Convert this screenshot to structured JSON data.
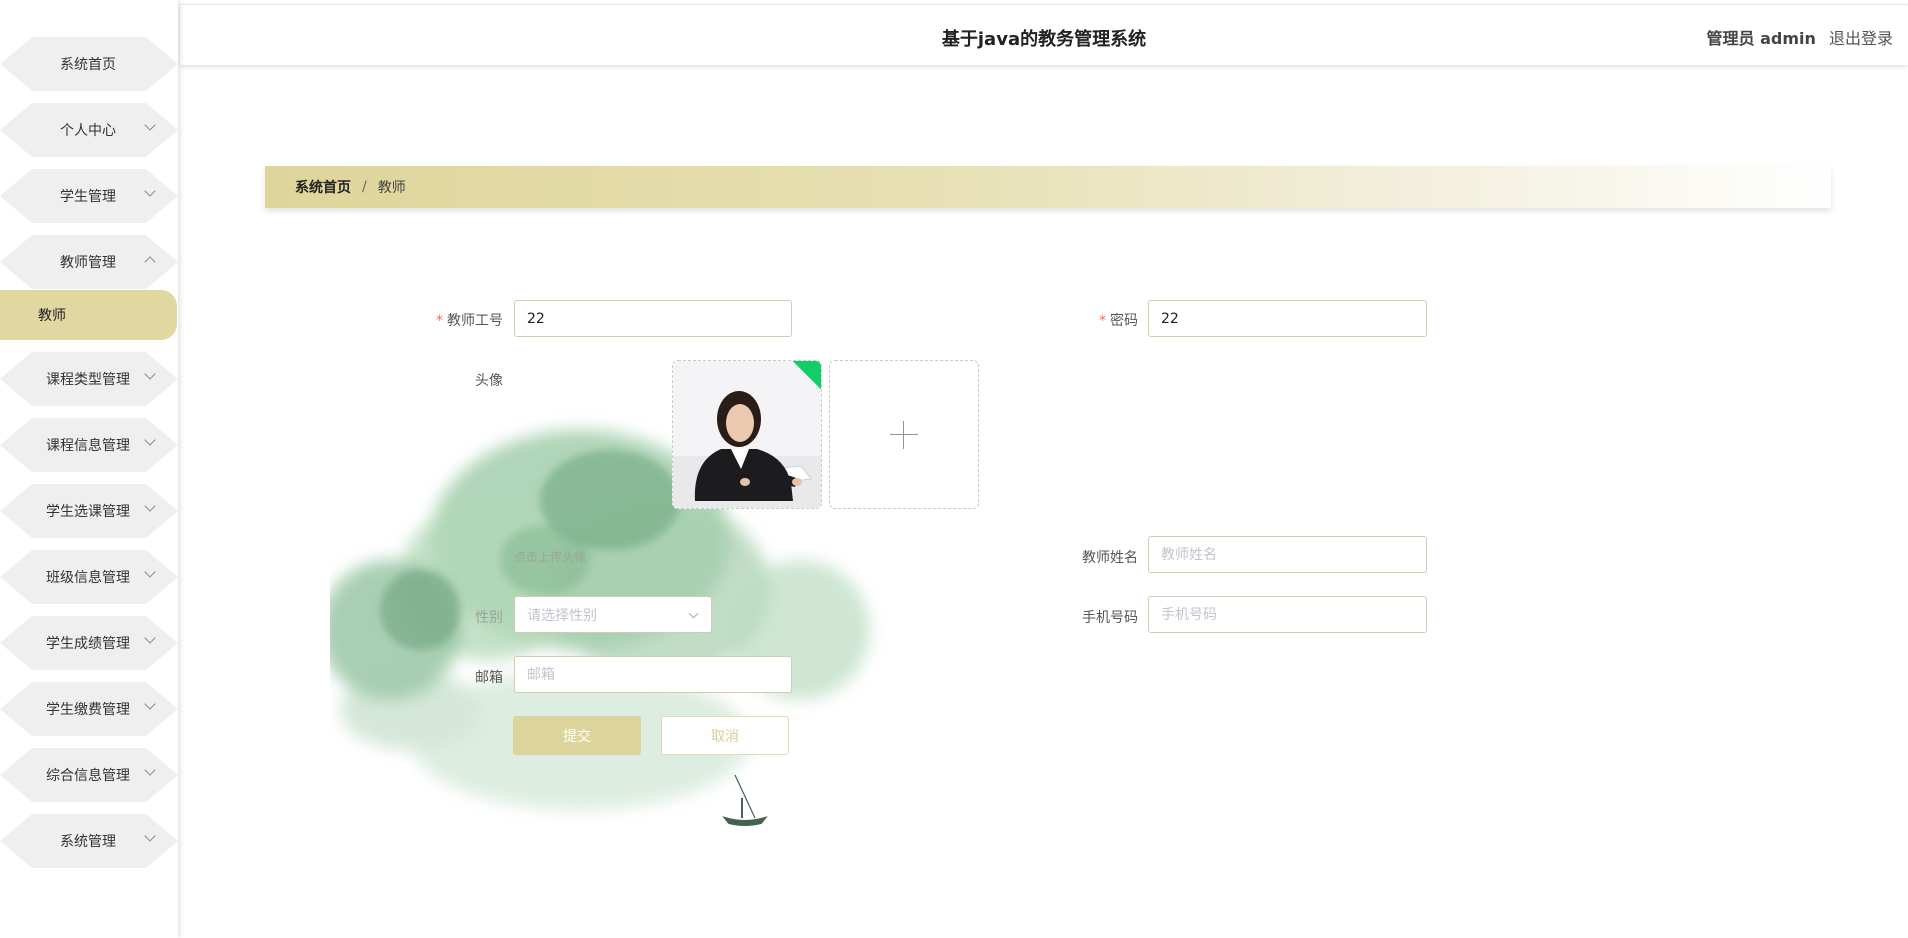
{
  "app": {
    "title": "基于java的教务管理系统"
  },
  "header": {
    "user_label": "管理员 admin",
    "logout_label": "退出登录"
  },
  "sidebar": {
    "items": [
      {
        "label": "系统首页",
        "chevron": "none"
      },
      {
        "label": "个人中心",
        "chevron": "down"
      },
      {
        "label": "学生管理",
        "chevron": "down"
      },
      {
        "label": "教师管理",
        "chevron": "up"
      },
      {
        "label": "课程类型管理",
        "chevron": "down"
      },
      {
        "label": "课程信息管理",
        "chevron": "down"
      },
      {
        "label": "学生选课管理",
        "chevron": "down"
      },
      {
        "label": "班级信息管理",
        "chevron": "down"
      },
      {
        "label": "学生成绩管理",
        "chevron": "down"
      },
      {
        "label": "学生缴费管理",
        "chevron": "down"
      },
      {
        "label": "综合信息管理",
        "chevron": "down"
      },
      {
        "label": "系统管理",
        "chevron": "down"
      }
    ],
    "active_submenu": "教师"
  },
  "breadcrumb": {
    "home": "系统首页",
    "separator": "/",
    "current": "教师"
  },
  "form": {
    "teacher_id": {
      "label": "教师工号",
      "value": "22",
      "required": true
    },
    "password": {
      "label": "密码",
      "value": "22",
      "required": true
    },
    "avatar": {
      "label": "头像",
      "tip": "点击上传头像"
    },
    "teacher_name": {
      "label": "教师姓名",
      "value": "",
      "placeholder": "教师姓名"
    },
    "gender": {
      "label": "性别",
      "placeholder": "请选择性别"
    },
    "phone": {
      "label": "手机号码",
      "value": "",
      "placeholder": "手机号码"
    },
    "email": {
      "label": "邮箱",
      "value": "",
      "placeholder": "邮箱"
    },
    "submit_label": "提交",
    "cancel_label": "取消",
    "required_mark": "*"
  },
  "colors": {
    "accent": "#ddd49c",
    "active_menu": "#e0d7a1",
    "required": "#f56c6c",
    "upload_badge": "#13ce66"
  }
}
